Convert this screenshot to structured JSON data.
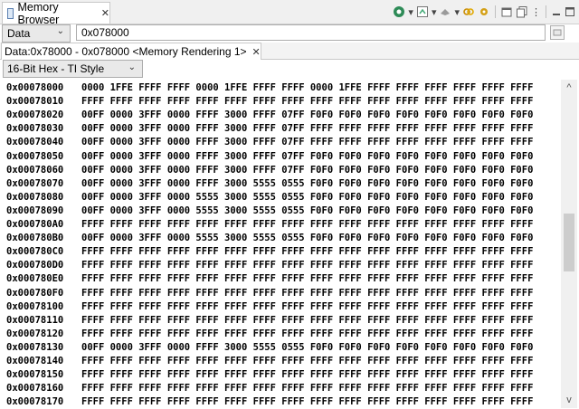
{
  "view": {
    "title": "Memory Browser",
    "close": "✕"
  },
  "toolbar": {
    "icons": [
      "connect-icon",
      "dropdown-arrow-icon",
      "refresh-icon",
      "dropdown-arrow-icon",
      "import-icon",
      "dropdown-arrow-icon",
      "link-icon",
      "settings-icon",
      "new-tab-icon",
      "copy-icon",
      "view-menu-icon",
      "minimize-icon",
      "maximize-icon"
    ]
  },
  "address_bar": {
    "space_selected": "Data",
    "address_value": "0x078000"
  },
  "rendering_tab": {
    "label": "Data:0x78000 - 0x078000 <Memory Rendering 1>",
    "close": "✕"
  },
  "format_selected": "16-Bit Hex - TI Style",
  "memory": {
    "rows": [
      {
        "addr": "0x00078000",
        "data": "0000 1FFE FFFF FFFF 0000 1FFE FFFF FFFF 0000 1FFE FFFF FFFF FFFF FFFF FFFF FFFF"
      },
      {
        "addr": "0x00078010",
        "data": "FFFF FFFF FFFF FFFF FFFF FFFF FFFF FFFF FFFF FFFF FFFF FFFF FFFF FFFF FFFF FFFF"
      },
      {
        "addr": "0x00078020",
        "data": "00FF 0000 3FFF 0000 FFFF 3000 FFFF 07FF F0F0 F0F0 F0F0 F0F0 F0F0 F0F0 F0F0 F0F0"
      },
      {
        "addr": "0x00078030",
        "data": "00FF 0000 3FFF 0000 FFFF 3000 FFFF 07FF FFFF FFFF FFFF FFFF FFFF FFFF FFFF FFFF"
      },
      {
        "addr": "0x00078040",
        "data": "00FF 0000 3FFF 0000 FFFF 3000 FFFF 07FF FFFF FFFF FFFF FFFF FFFF FFFF FFFF FFFF"
      },
      {
        "addr": "0x00078050",
        "data": "00FF 0000 3FFF 0000 FFFF 3000 FFFF 07FF F0F0 F0F0 F0F0 F0F0 F0F0 F0F0 F0F0 F0F0"
      },
      {
        "addr": "0x00078060",
        "data": "00FF 0000 3FFF 0000 FFFF 3000 FFFF 07FF F0F0 F0F0 F0F0 F0F0 F0F0 F0F0 F0F0 F0F0"
      },
      {
        "addr": "0x00078070",
        "data": "00FF 0000 3FFF 0000 FFFF 3000 5555 0555 F0F0 F0F0 F0F0 F0F0 F0F0 F0F0 F0F0 F0F0"
      },
      {
        "addr": "0x00078080",
        "data": "00FF 0000 3FFF 0000 5555 3000 5555 0555 F0F0 F0F0 F0F0 F0F0 F0F0 F0F0 F0F0 F0F0"
      },
      {
        "addr": "0x00078090",
        "data": "00FF 0000 3FFF 0000 5555 3000 5555 0555 F0F0 F0F0 F0F0 F0F0 F0F0 F0F0 F0F0 F0F0"
      },
      {
        "addr": "0x000780A0",
        "data": "FFFF FFFF FFFF FFFF FFFF FFFF FFFF FFFF FFFF FFFF FFFF FFFF FFFF FFFF FFFF FFFF"
      },
      {
        "addr": "0x000780B0",
        "data": "00FF 0000 3FFF 0000 5555 3000 5555 0555 F0F0 F0F0 F0F0 F0F0 F0F0 F0F0 F0F0 F0F0"
      },
      {
        "addr": "0x000780C0",
        "data": "FFFF FFFF FFFF FFFF FFFF FFFF FFFF FFFF FFFF FFFF FFFF FFFF FFFF FFFF FFFF FFFF"
      },
      {
        "addr": "0x000780D0",
        "data": "FFFF FFFF FFFF FFFF FFFF FFFF FFFF FFFF FFFF FFFF FFFF FFFF FFFF FFFF FFFF FFFF"
      },
      {
        "addr": "0x000780E0",
        "data": "FFFF FFFF FFFF FFFF FFFF FFFF FFFF FFFF FFFF FFFF FFFF FFFF FFFF FFFF FFFF FFFF"
      },
      {
        "addr": "0x000780F0",
        "data": "FFFF FFFF FFFF FFFF FFFF FFFF FFFF FFFF FFFF FFFF FFFF FFFF FFFF FFFF FFFF FFFF"
      },
      {
        "addr": "0x00078100",
        "data": "FFFF FFFF FFFF FFFF FFFF FFFF FFFF FFFF FFFF FFFF FFFF FFFF FFFF FFFF FFFF FFFF"
      },
      {
        "addr": "0x00078110",
        "data": "FFFF FFFF FFFF FFFF FFFF FFFF FFFF FFFF FFFF FFFF FFFF FFFF FFFF FFFF FFFF FFFF"
      },
      {
        "addr": "0x00078120",
        "data": "FFFF FFFF FFFF FFFF FFFF FFFF FFFF FFFF FFFF FFFF FFFF FFFF FFFF FFFF FFFF FFFF"
      },
      {
        "addr": "0x00078130",
        "data": "00FF 0000 3FFF 0000 FFFF 3000 5555 0555 F0F0 F0F0 F0F0 F0F0 F0F0 F0F0 F0F0 F0F0"
      },
      {
        "addr": "0x00078140",
        "data": "FFFF FFFF FFFF FFFF FFFF FFFF FFFF FFFF FFFF FFFF FFFF FFFF FFFF FFFF FFFF FFFF"
      },
      {
        "addr": "0x00078150",
        "data": "FFFF FFFF FFFF FFFF FFFF FFFF FFFF FFFF FFFF FFFF FFFF FFFF FFFF FFFF FFFF FFFF"
      },
      {
        "addr": "0x00078160",
        "data": "FFFF FFFF FFFF FFFF FFFF FFFF FFFF FFFF FFFF FFFF FFFF FFFF FFFF FFFF FFFF FFFF"
      },
      {
        "addr": "0x00078170",
        "data": "FFFF FFFF FFFF FFFF FFFF FFFF FFFF FFFF FFFF FFFF FFFF FFFF FFFF FFFF FFFF FFFF"
      }
    ]
  }
}
